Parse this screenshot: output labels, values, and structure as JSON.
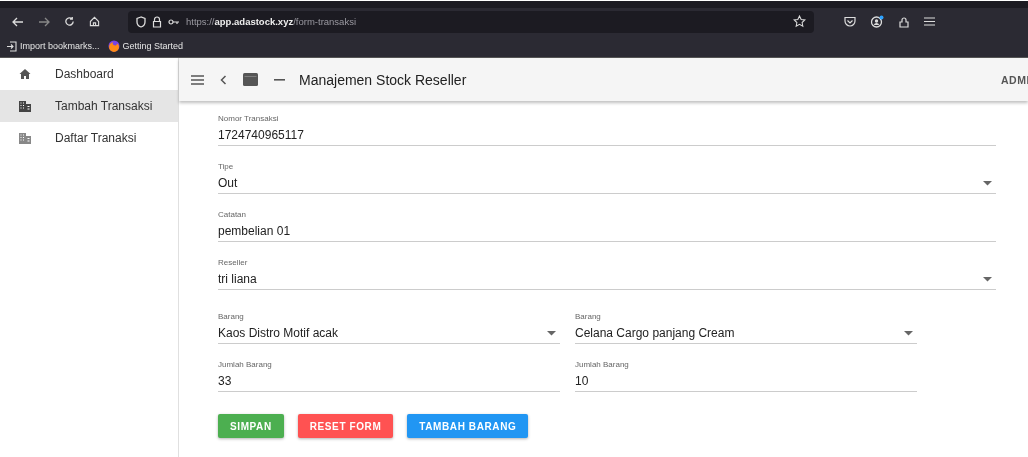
{
  "browser": {
    "url": "https://**app.adastock.xyz**/form-transaksi",
    "bookmarks": [
      {
        "label": "Import bookmarks...",
        "kind": "import"
      },
      {
        "label": "Getting Started",
        "kind": "globe"
      }
    ]
  },
  "sidebar": {
    "items": [
      {
        "label": "Dashboard",
        "kind": "home",
        "selected": false
      },
      {
        "label": "Tambah Transaksi",
        "kind": "building",
        "selected": true
      },
      {
        "label": "Daftar Tranaksi",
        "kind": "building",
        "selected": false
      }
    ]
  },
  "header": {
    "title": "Manajemen Stock Reseller",
    "user": "ADMI"
  },
  "form": {
    "fields": [
      {
        "label": "Nomor Transaksi",
        "value": "1724740965117",
        "kind": "text"
      },
      {
        "label": "Tipe",
        "value": "Out",
        "kind": "select"
      },
      {
        "label": "Catatan",
        "value": "pembelian 01",
        "kind": "text"
      },
      {
        "label": "Reseller",
        "value": "tri liana",
        "kind": "select"
      }
    ],
    "items": [
      {
        "barang": {
          "label": "Barang",
          "value": "Kaos Distro Motif acak"
        },
        "jumlah": {
          "label": "Jumlah Barang",
          "value": "33"
        }
      },
      {
        "barang": {
          "label": "Barang",
          "value": "Celana Cargo panjang Cream"
        },
        "jumlah": {
          "label": "Jumlah Barang",
          "value": "10"
        }
      }
    ],
    "buttons": [
      {
        "label": "SIMPAN",
        "color": "#4caf50"
      },
      {
        "label": "RESET FORM",
        "color": "#ff5252"
      },
      {
        "label": "TAMBAH BARANG",
        "color": "#2196f3"
      }
    ]
  }
}
